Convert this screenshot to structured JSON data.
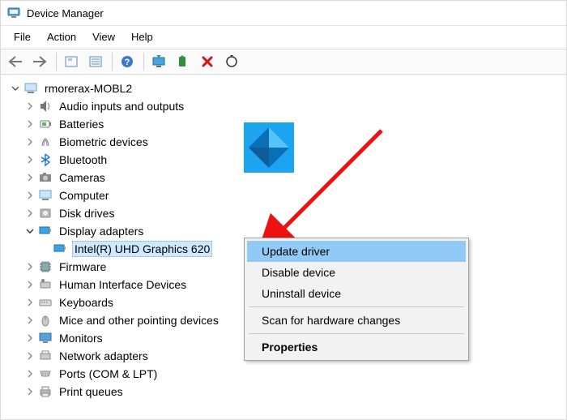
{
  "title": "Device Manager",
  "menubar": {
    "file": "File",
    "action": "Action",
    "view": "View",
    "help": "Help"
  },
  "toolbar": {
    "back": "Back",
    "forward": "Forward",
    "show_hidden": "Show hidden devices",
    "properties_pane": "Properties pane",
    "help_btn": "Help",
    "update_driver_btn": "Update device driver",
    "enable_btn": "Enable device",
    "uninstall_btn": "Uninstall device",
    "scan_btn": "Scan for hardware changes"
  },
  "tree": {
    "root": "rmorerax-MOBL2",
    "items": [
      {
        "id": "audio",
        "label": "Audio inputs and outputs"
      },
      {
        "id": "batteries",
        "label": "Batteries"
      },
      {
        "id": "biometric",
        "label": "Biometric devices"
      },
      {
        "id": "bluetooth",
        "label": "Bluetooth"
      },
      {
        "id": "cameras",
        "label": "Cameras"
      },
      {
        "id": "computer",
        "label": "Computer"
      },
      {
        "id": "disk",
        "label": "Disk drives"
      },
      {
        "id": "display",
        "label": "Display adapters",
        "expanded": true,
        "children": [
          {
            "id": "intel620",
            "label": "Intel(R) UHD Graphics 620",
            "selected": true
          }
        ]
      },
      {
        "id": "firmware",
        "label": "Firmware"
      },
      {
        "id": "hid",
        "label": "Human Interface Devices"
      },
      {
        "id": "keyboards",
        "label": "Keyboards"
      },
      {
        "id": "mice",
        "label": "Mice and other pointing devices"
      },
      {
        "id": "monitors",
        "label": "Monitors"
      },
      {
        "id": "network",
        "label": "Network adapters"
      },
      {
        "id": "ports",
        "label": "Ports (COM & LPT)"
      },
      {
        "id": "printq",
        "label": "Print queues"
      }
    ]
  },
  "context_menu": {
    "update": "Update driver",
    "disable": "Disable device",
    "uninstall": "Uninstall device",
    "scan": "Scan for hardware changes",
    "props": "Properties",
    "highlighted": "update"
  }
}
